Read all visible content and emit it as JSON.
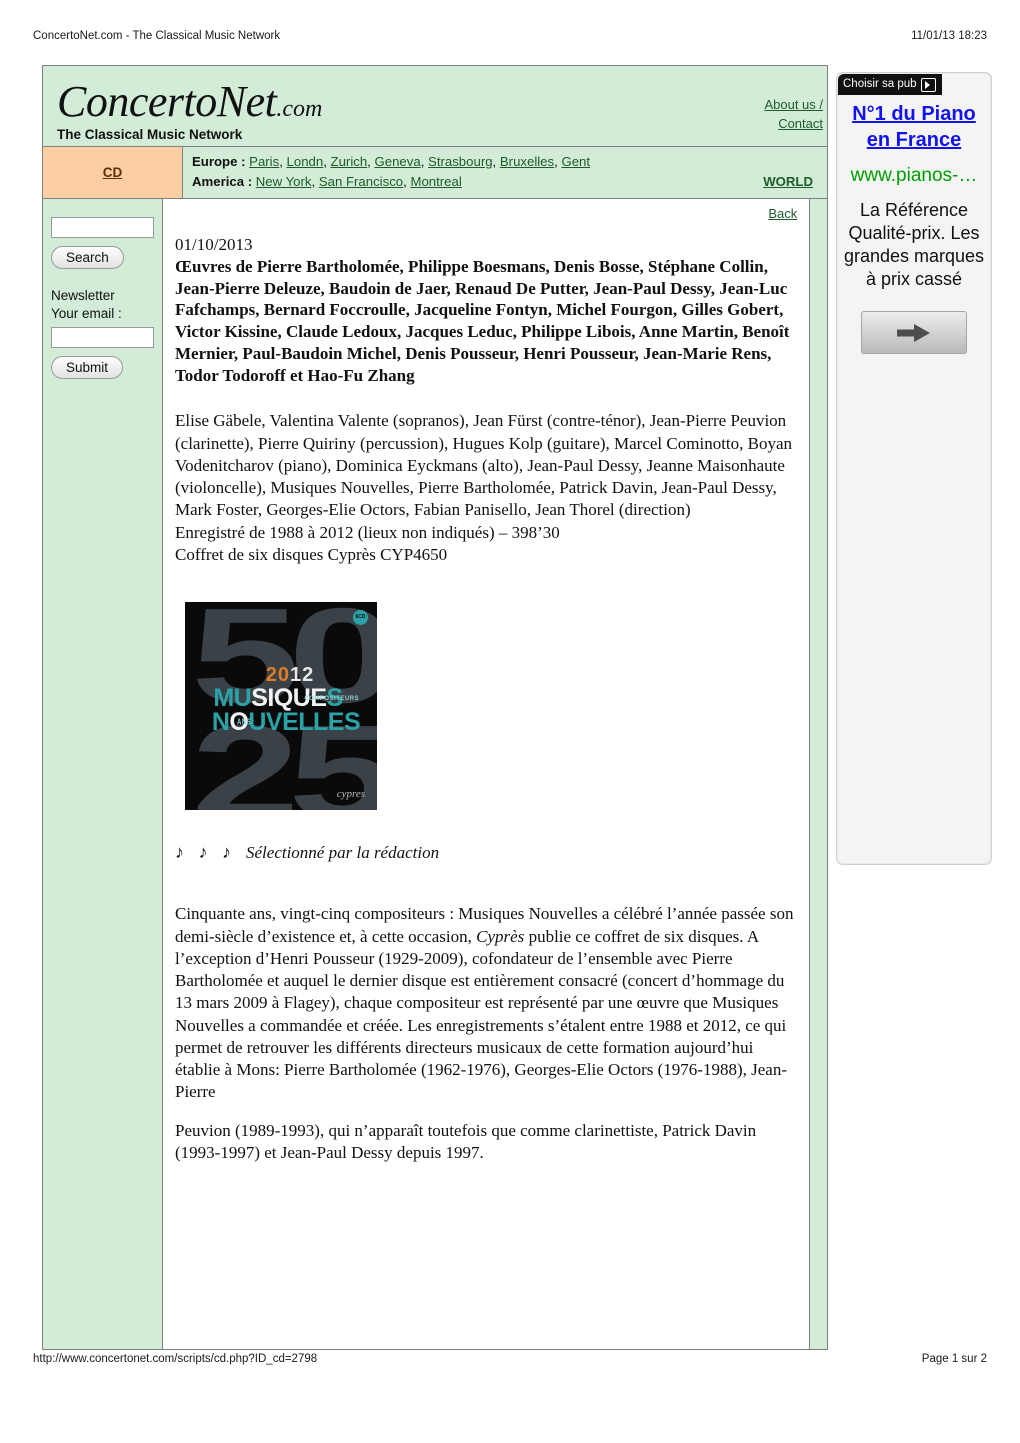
{
  "print": {
    "header_left": "ConcertoNet.com - The Classical Music Network",
    "header_right": "11/01/13 18:23",
    "footer_left": "http://www.concertonet.com/scripts/cd.php?ID_cd=2798",
    "footer_right": "Page 1 sur 2"
  },
  "site": {
    "logo_text": "ConcertoNet",
    "logo_tld": ".com",
    "tagline": "The Classical Music Network",
    "about_line1": "About us /",
    "about_line2": "Contact"
  },
  "nav": {
    "cd_label": "CD",
    "europe_label": "Europe :",
    "europe_cities": [
      "Paris",
      "Londn",
      "Zurich",
      "Geneva",
      "Strasbourg",
      "Bruxelles",
      "Gent"
    ],
    "america_label": "America :",
    "america_cities": [
      "New York",
      "San Francisco",
      "Montreal"
    ],
    "world_label": "WORLD"
  },
  "sidebar": {
    "search_value": "",
    "search_placeholder": "",
    "search_button": "Search",
    "newsletter_label": "Newsletter",
    "email_label": "Your email :",
    "email_value": "",
    "email_placeholder": "",
    "submit_button": "Submit"
  },
  "content": {
    "back_link": "Back",
    "date": "01/10/2013",
    "title": "Œuvres de Pierre Bartholomée, Philippe Boesmans, Denis Bosse, Stéphane Collin, Jean-Pierre Deleuze, Baudoin de Jaer, Renaud De Putter, Jean-Paul Dessy, Jean-Luc Fafchamps, Bernard Foccroulle, Jacqueline Fontyn, Michel Fourgon, Gilles Gobert, Victor Kissine, Claude Ledoux, Jacques Leduc, Philippe Libois, Anne Martin, Benoît Mernier, Paul-Baudoin Michel, Denis Pousseur, Henri Pousseur, Jean-Marie Rens, Todor Todoroff et Hao-Fu Zhang",
    "performers": "Elise Gäbele, Valentina Valente (sopranos), Jean Fürst (contre-ténor), Jean-Pierre Peuvion (clarinette), Pierre Quiriny (percussion), Hugues Kolp (guitare), Marcel Cominotto, Boyan Vodenitcharov (piano), Dominica Eyckmans (alto), Jean-Paul Dessy, Jeanne Maisonhaute (violoncelle), Musiques Nouvelles, Pierre Bartholomée, Patrick Davin, Jean-Paul Dessy, Mark Foster, Georges-Elie Octors, Fabian Panisello, Jean Thorel (direction)\nEnregistré de 1988 à 2012 (lieux non indiqués) – 398’30\nCoffret de six disques Cyprès CYP4650",
    "cover": {
      "big_top": "50",
      "big_bottom": "25",
      "year": "2012",
      "line1": "MUSIQUES",
      "line2": "NOUVELLES",
      "small_right": "COMPOSITEURS",
      "small_left": "ANS",
      "badge": "6CD",
      "label_logo": "cypres"
    },
    "selection_notes": "♪ ♪ ♪",
    "selection_text": "Sélectionné par la rédaction",
    "review_p1_a": "Cinquante ans, vingt-cinq compositeurs : Musiques Nouvelles a célébré l’année passée son demi-siècle d’existence et, à cette occasion, ",
    "review_p1_italic": "Cyprès",
    "review_p1_b": " publie ce coffret de six disques. A l’exception d’Henri Pousseur (1929-2009), cofondateur de l’ensemble avec Pierre Bartholomée et auquel le dernier disque est entièrement consacré (concert d’hommage du 13 mars 2009 à Flagey), chaque compositeur est représenté par une œuvre que Musiques Nouvelles a commandée et créée. Les enregistrements s’étalent entre 1988 et 2012, ce qui permet de retrouver les différents directeurs musicaux de cette formation aujourd’hui établie à Mons: Pierre Bartholomée (1962-1976), Georges-Elie Octors (1976-1988), Jean-Pierre",
    "review_p2": "Peuvion (1989-1993), qui n’apparaît toutefois que comme clarinettiste, Patrick Davin (1993-1997) et Jean-Paul Dessy depuis 1997."
  },
  "ad": {
    "tab_label": "Choisir sa pub",
    "title": "N°1 du Piano en France",
    "url": "www.pianos-…",
    "description": "La Référence Qualité-prix. Les grandes marques à prix cassé",
    "button_icon": "arrow-right-icon"
  },
  "colors": {
    "page_green": "#d3ecd8",
    "cd_orange": "#fbcfa2",
    "link_green": "#1d5c2a",
    "ad_blue": "#1313ef",
    "ad_green": "#00a000"
  }
}
